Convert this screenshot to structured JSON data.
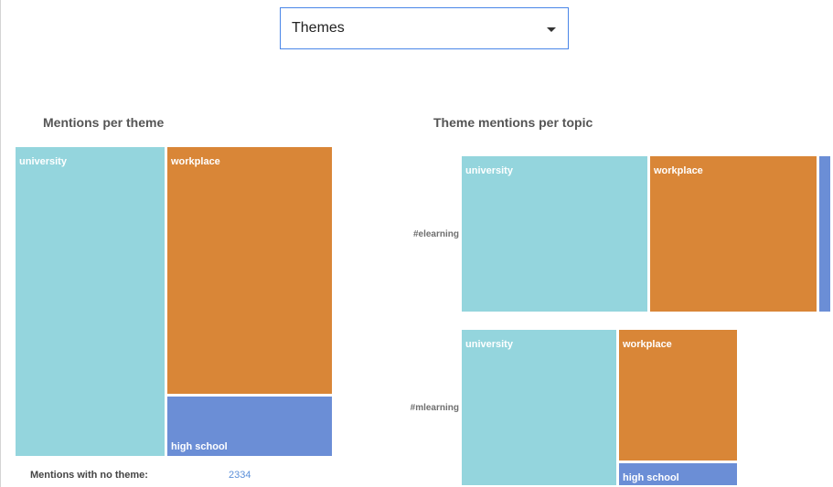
{
  "dropdown": {
    "selected": "Themes"
  },
  "colors": {
    "university": "#94d5dd",
    "workplace": "#d98637",
    "high school": "#6b8ed6"
  },
  "chart_data": [
    {
      "type": "treemap",
      "title": "Mentions per theme",
      "items": [
        {
          "label": "university",
          "value": 48
        },
        {
          "label": "workplace",
          "value": 42
        },
        {
          "label": "high school",
          "value": 10
        }
      ]
    },
    {
      "type": "treemap",
      "title": "Theme mentions per topic",
      "rows": [
        {
          "label": "#elearning",
          "items": [
            {
              "label": "university",
              "value": 51
            },
            {
              "label": "workplace",
              "value": 46
            },
            {
              "label": "high school",
              "value": 3
            }
          ]
        },
        {
          "label": "#mlearning",
          "items": [
            {
              "label": "university",
              "value": 57
            },
            {
              "label": "workplace",
              "value": 37
            },
            {
              "label": "high school",
              "value": 6
            }
          ]
        }
      ]
    }
  ],
  "summary": {
    "no_theme_label": "Mentions with no theme:",
    "no_theme_value": "2334"
  }
}
